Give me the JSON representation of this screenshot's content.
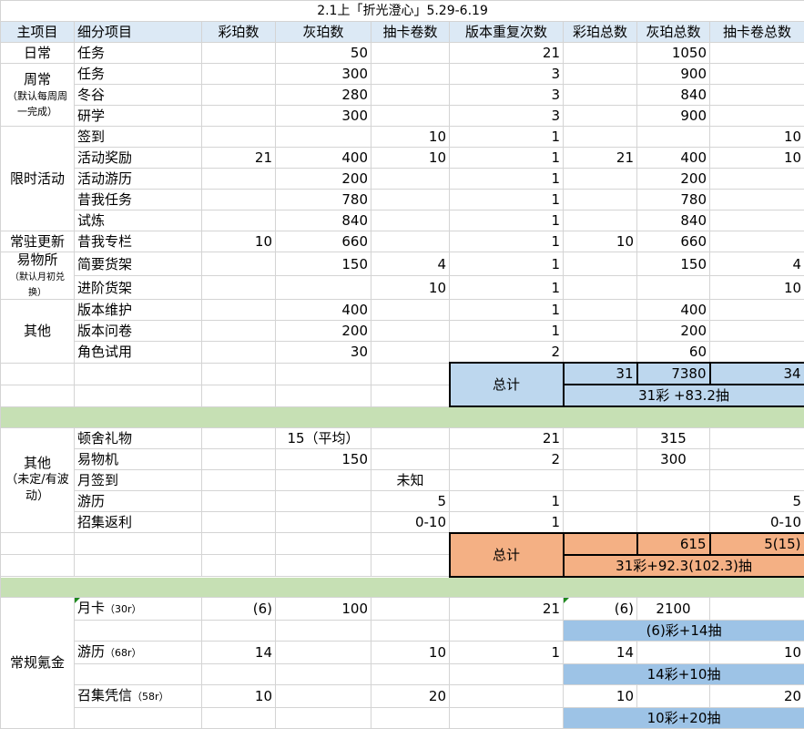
{
  "title": "2.1上「折光澄心」5.29-6.19",
  "headers": [
    "主项目",
    "细分项目",
    "彩珀数",
    "灰珀数",
    "抽卡卷数",
    "版本重复次数",
    "彩珀总数",
    "灰珀总数",
    "抽卡卷总数"
  ],
  "groups": {
    "daily": "日常",
    "weekly": "周常",
    "weekly_note": "（默认每周周一完成）",
    "limited": "限时活动",
    "permanent": "常驻更新",
    "shop": "易物所",
    "shop_note": "（默认月初兑换）",
    "other": "其他",
    "other2": "其他",
    "other2_note": "（未定/有波动）",
    "paid": "常规氪金"
  },
  "rows": {
    "daily_task": {
      "name": "任务",
      "gray": "50",
      "rep": "21",
      "gray_total": "1050"
    },
    "weekly_task": {
      "name": "任务",
      "gray": "300",
      "rep": "3",
      "gray_total": "900"
    },
    "winter_valley": {
      "name": "冬谷",
      "gray": "280",
      "rep": "3",
      "gray_total": "840"
    },
    "research": {
      "name": "研学",
      "gray": "300",
      "rep": "3",
      "gray_total": "900"
    },
    "signin": {
      "name": "签到",
      "ticket": "10",
      "rep": "1",
      "ticket_total": "10"
    },
    "event_reward": {
      "name": "活动奖励",
      "color": "21",
      "gray": "400",
      "ticket": "10",
      "rep": "1",
      "color_total": "21",
      "gray_total": "400",
      "ticket_total": "10"
    },
    "event_tour": {
      "name": "活动游历",
      "gray": "200",
      "rep": "1",
      "gray_total": "200"
    },
    "past_task": {
      "name": "昔我任务",
      "gray": "780",
      "rep": "1",
      "gray_total": "780"
    },
    "trial": {
      "name": "试炼",
      "gray": "840",
      "rep": "1",
      "gray_total": "840"
    },
    "past_column": {
      "name": "昔我专栏",
      "color": "10",
      "gray": "660",
      "rep": "1",
      "color_total": "10",
      "gray_total": "660"
    },
    "simple_shelf": {
      "name": "简要货架",
      "gray": "150",
      "ticket": "4",
      "rep": "1",
      "gray_total": "150",
      "ticket_total": "4"
    },
    "adv_shelf": {
      "name": "进阶货架",
      "ticket": "10",
      "rep": "1",
      "ticket_total": "10"
    },
    "maintenance": {
      "name": "版本维护",
      "gray": "400",
      "rep": "1",
      "gray_total": "400"
    },
    "survey": {
      "name": "版本问卷",
      "gray": "200",
      "rep": "1",
      "gray_total": "200"
    },
    "char_trial": {
      "name": "角色试用",
      "gray": "30",
      "rep": "2",
      "gray_total": "60"
    },
    "dorm_gift": {
      "name": "顿舍礼物",
      "gray": "15（平均）",
      "rep": "21",
      "gray_total": "315"
    },
    "barter": {
      "name": "易物机",
      "gray": "150",
      "rep": "2",
      "gray_total": "300"
    },
    "monthly_signin": {
      "name": "月签到",
      "ticket": "未知"
    },
    "tour": {
      "name": "游历",
      "ticket": "5",
      "rep": "1",
      "ticket_total": "5"
    },
    "recruit_rebate": {
      "name": "招集返利",
      "ticket": "0-10",
      "rep": "1",
      "ticket_total": "0-10"
    },
    "monthly_card": {
      "name": "月卡",
      "price": "（30r）",
      "color": "(6)",
      "gray": "100",
      "rep": "21",
      "color_total": "(6)",
      "gray_total": "2100",
      "summary": "(6)彩+14抽"
    },
    "paid_tour": {
      "name": "游历",
      "price": "（68r）",
      "color": "14",
      "ticket": "10",
      "rep": "1",
      "color_total": "14",
      "ticket_total": "10",
      "summary": "14彩+10抽"
    },
    "recruit_pass": {
      "name": "召集凭信",
      "price": "（58r）",
      "color": "10",
      "ticket": "20",
      "color_total": "10",
      "ticket_total": "20",
      "summary": "10彩+20抽"
    }
  },
  "total1": {
    "label": "总计",
    "color": "31",
    "gray": "7380",
    "ticket": "34",
    "summary": "31彩 +83.2抽"
  },
  "total2": {
    "label": "总计",
    "gray": "615",
    "ticket": "5(15)",
    "summary": "31彩+92.3(102.3)抽"
  },
  "colors": {
    "header_bg": "#dce9f5",
    "separator": "#c6e0b4",
    "total1": "#bdd7ee",
    "total2": "#f4b084",
    "paid_summary": "#9dc3e6"
  }
}
